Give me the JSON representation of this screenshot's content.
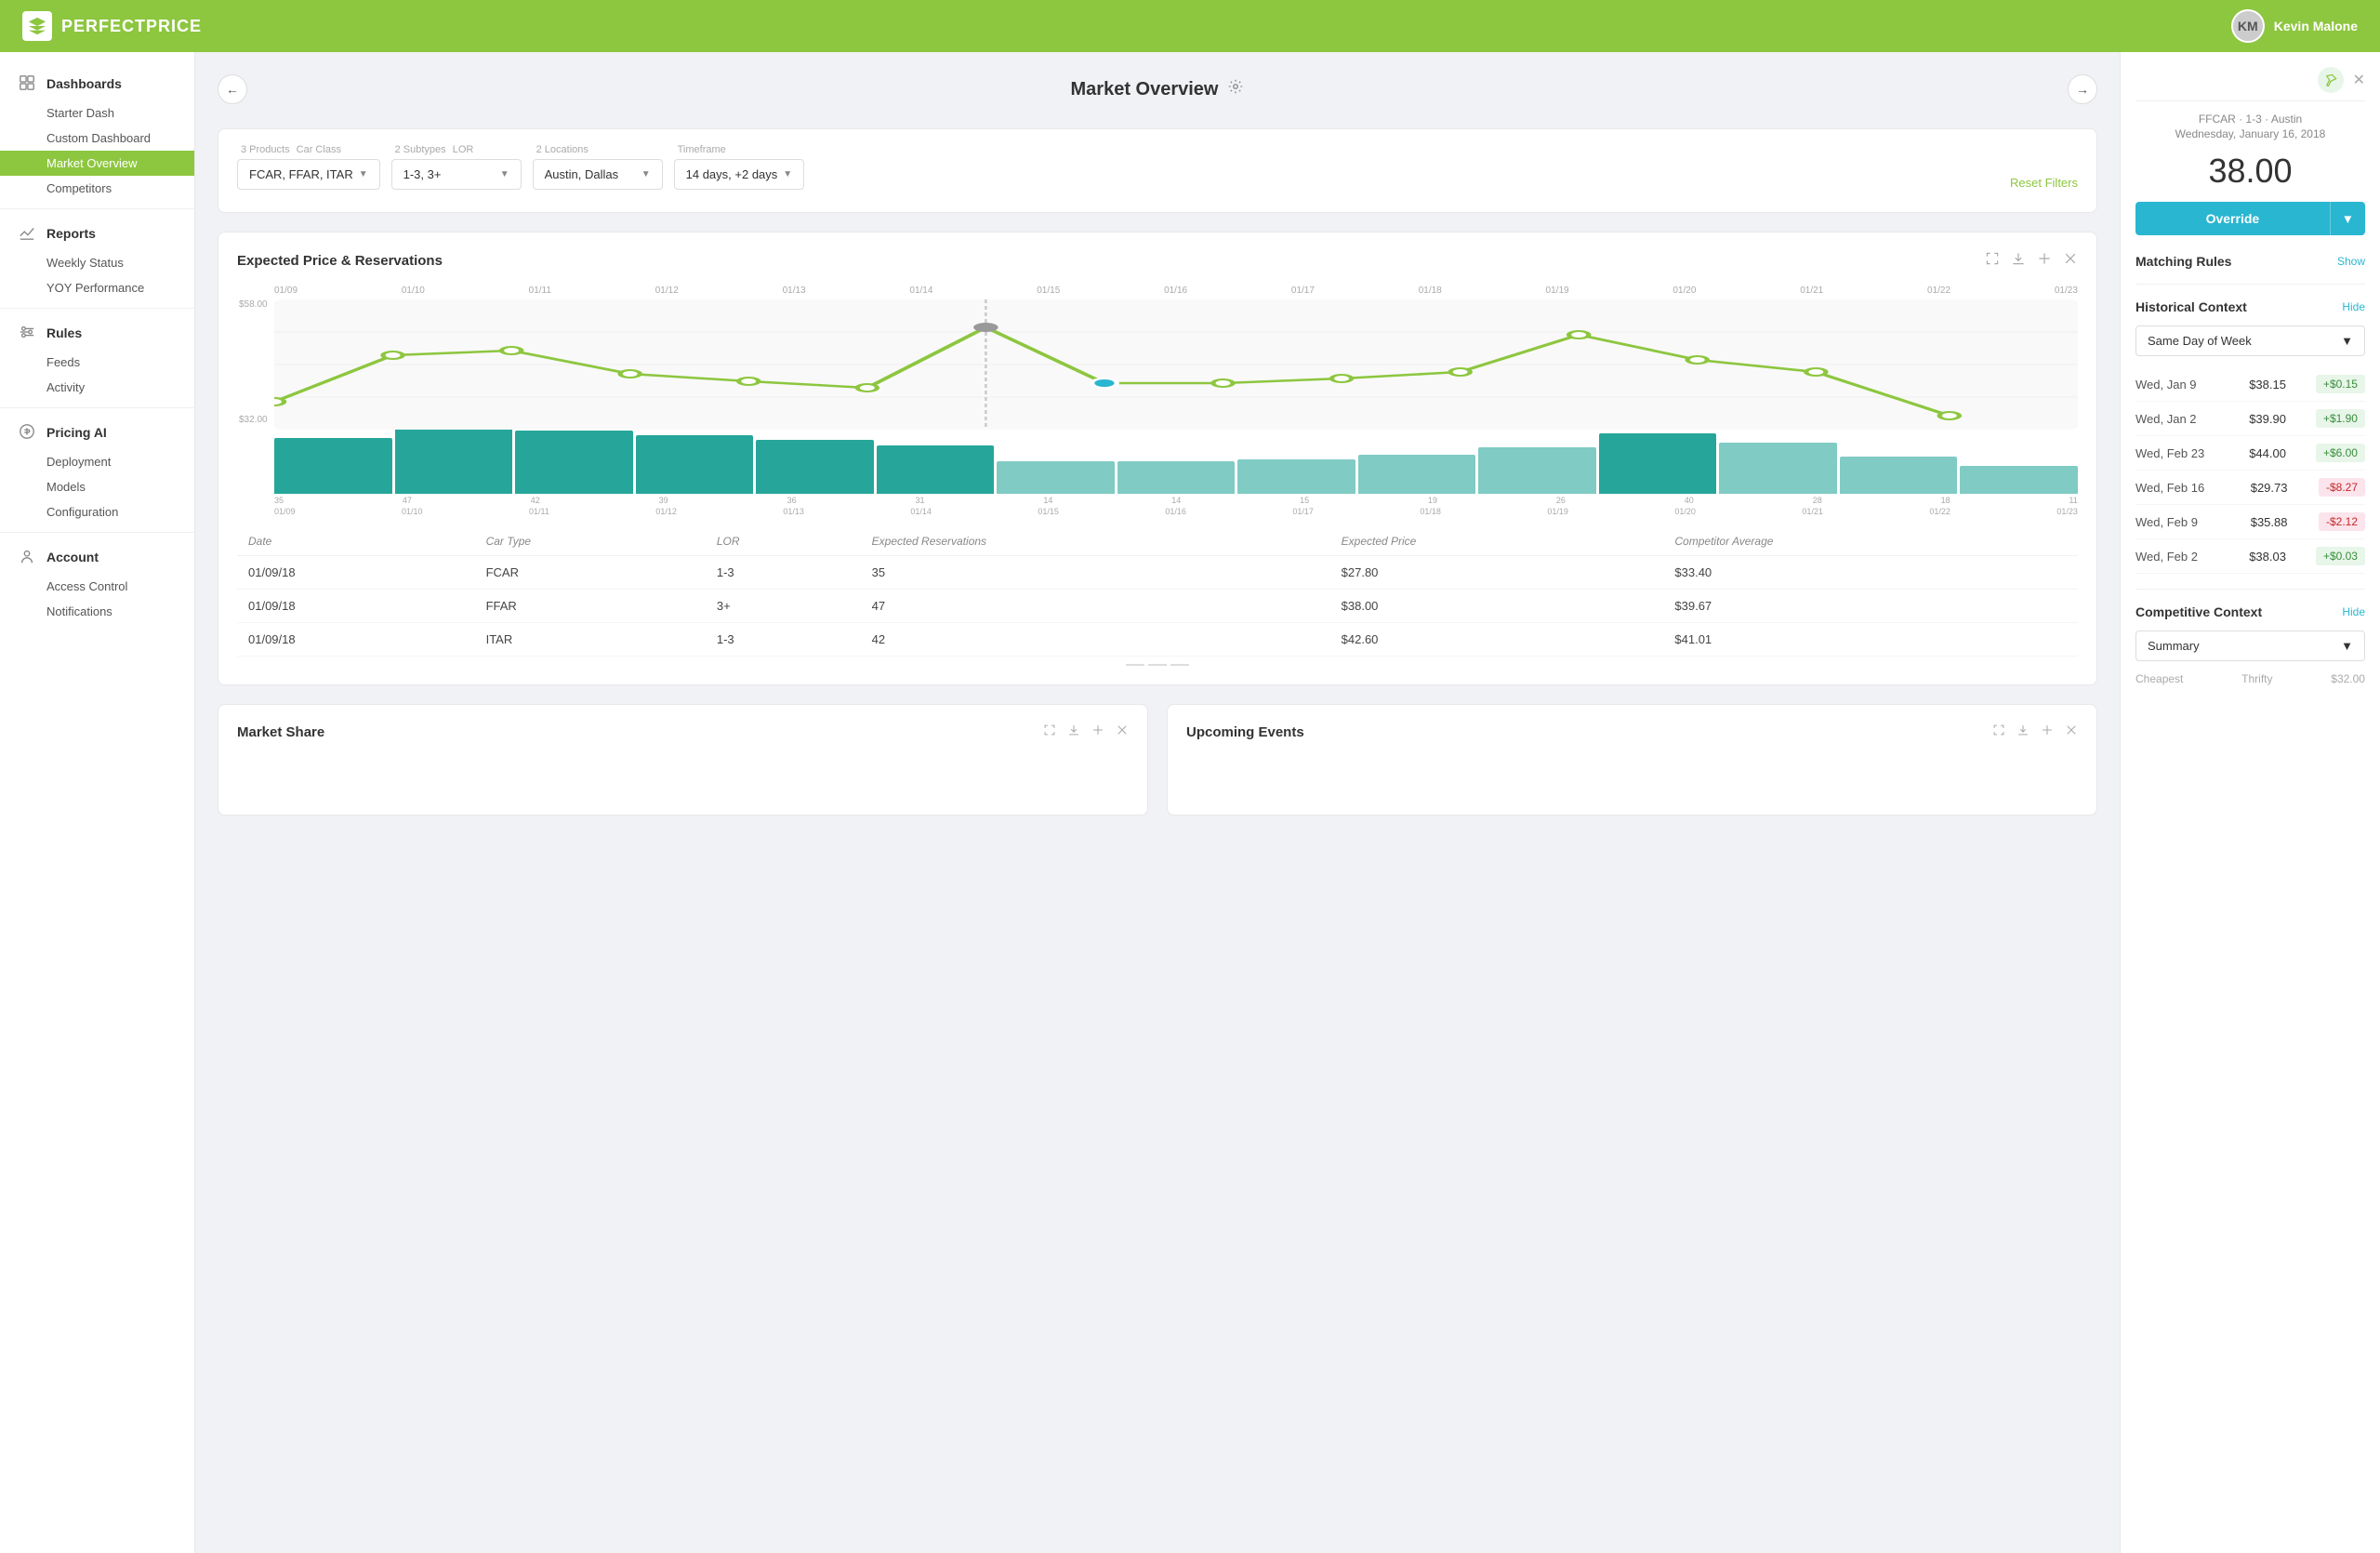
{
  "app": {
    "name": "PERFECTPRICE",
    "user": "Kevin Malone"
  },
  "sidebar": {
    "sections": [
      {
        "group": "Dashboards",
        "icon": "dashboard-icon",
        "items": [
          "Starter Dash",
          "Custom Dashboard",
          "Market Overview",
          "Competitors"
        ]
      },
      {
        "group": "Reports",
        "icon": "reports-icon",
        "items": [
          "Weekly Status",
          "YOY Performance"
        ]
      },
      {
        "group": "Rules",
        "icon": "rules-icon",
        "items": [
          "Feeds",
          "Activity"
        ]
      },
      {
        "group": "Pricing AI",
        "icon": "pricing-icon",
        "items": [
          "Deployment",
          "Models",
          "Configuration"
        ]
      },
      {
        "group": "Account",
        "icon": "account-icon",
        "items": [
          "Access Control",
          "Notifications"
        ]
      }
    ],
    "active_item": "Market Overview"
  },
  "page": {
    "title": "Market Overview",
    "filters": {
      "products": {
        "label": "3 Products",
        "sublabel": "Car Class",
        "value": "FCAR, FFAR, ITAR"
      },
      "subtypes": {
        "label": "2 Subtypes",
        "sublabel": "LOR",
        "value": "1-3, 3+"
      },
      "locations": {
        "label": "2 Locations",
        "sublabel": "",
        "value": "Austin, Dallas"
      },
      "timeframe": {
        "label": "Timeframe",
        "sublabel": "",
        "value": "14 days, +2 days"
      }
    },
    "reset_label": "Reset Filters"
  },
  "chart": {
    "title": "Expected Price & Reservations",
    "dates": [
      "01/09",
      "01/10",
      "01/11",
      "01/12",
      "01/13",
      "01/14",
      "01/15",
      "01/16",
      "01/17",
      "01/18",
      "01/19",
      "01/20",
      "01/21",
      "01/22",
      "01/23"
    ],
    "price_top": "$58.00",
    "price_bottom": "$32.00",
    "bars": [
      {
        "count": 35,
        "date": "01/09",
        "height": 60,
        "dark": true
      },
      {
        "count": 47,
        "date": "01/10",
        "height": 75,
        "dark": true
      },
      {
        "count": 42,
        "date": "01/11",
        "height": 68,
        "dark": true
      },
      {
        "count": 39,
        "date": "01/12",
        "height": 63,
        "dark": true
      },
      {
        "count": 36,
        "date": "01/13",
        "height": 58,
        "dark": true
      },
      {
        "count": 31,
        "date": "01/14",
        "height": 52,
        "dark": true
      },
      {
        "count": 14,
        "date": "01/15",
        "height": 35,
        "dark": false
      },
      {
        "count": 14,
        "date": "01/16",
        "height": 35,
        "dark": false
      },
      {
        "count": 15,
        "date": "01/17",
        "height": 37,
        "dark": false
      },
      {
        "count": 19,
        "date": "01/18",
        "height": 42,
        "dark": false
      },
      {
        "count": 26,
        "date": "01/19",
        "height": 50,
        "dark": false
      },
      {
        "count": 40,
        "date": "01/20",
        "height": 65,
        "dark": true
      },
      {
        "count": 28,
        "date": "01/21",
        "height": 55,
        "dark": false
      },
      {
        "count": 18,
        "date": "01/22",
        "height": 40,
        "dark": false
      },
      {
        "count": 11,
        "date": "01/23",
        "height": 30,
        "dark": false
      }
    ],
    "table": {
      "columns": [
        "Date",
        "Car Type",
        "LOR",
        "Expected Reservations",
        "Expected Price",
        "Competitor Average"
      ],
      "rows": [
        [
          "01/09/18",
          "FCAR",
          "1-3",
          "35",
          "$27.80",
          "$33.40"
        ],
        [
          "01/09/18",
          "FFAR",
          "3+",
          "47",
          "$38.00",
          "$39.67"
        ],
        [
          "01/09/18",
          "ITAR",
          "1-3",
          "42",
          "$42.60",
          "$41.01"
        ]
      ]
    }
  },
  "bottom_cards": [
    {
      "title": "Market Share"
    },
    {
      "title": "Upcoming Events"
    }
  ],
  "right_panel": {
    "context": "FFCAR · 1-3 · Austin",
    "date": "Wednesday, January 16, 2018",
    "price": "38.00",
    "override_label": "Override",
    "matching_rules": {
      "title": "Matching Rules",
      "action": "Show"
    },
    "historical_context": {
      "title": "Historical Context",
      "action": "Hide",
      "selector": "Same Day of Week",
      "rows": [
        {
          "date": "Wed, Jan 9",
          "price": "$38.15",
          "diff": "+$0.15",
          "positive": true
        },
        {
          "date": "Wed, Jan 2",
          "price": "$39.90",
          "diff": "+$1.90",
          "positive": true
        },
        {
          "date": "Wed, Feb 23",
          "price": "$44.00",
          "diff": "+$6.00",
          "positive": true
        },
        {
          "date": "Wed, Feb 16",
          "price": "$29.73",
          "diff": "-$8.27",
          "positive": false
        },
        {
          "date": "Wed, Feb 9",
          "price": "$35.88",
          "diff": "-$2.12",
          "positive": false
        },
        {
          "date": "Wed, Feb 2",
          "price": "$38.03",
          "diff": "+$0.03",
          "positive": true
        }
      ]
    },
    "competitive_context": {
      "title": "Competitive Context",
      "action": "Hide",
      "selector": "Summary",
      "footer": {
        "cheapest": "Cheapest",
        "thrifty": "Thrifty",
        "price": "$32.00"
      }
    }
  }
}
